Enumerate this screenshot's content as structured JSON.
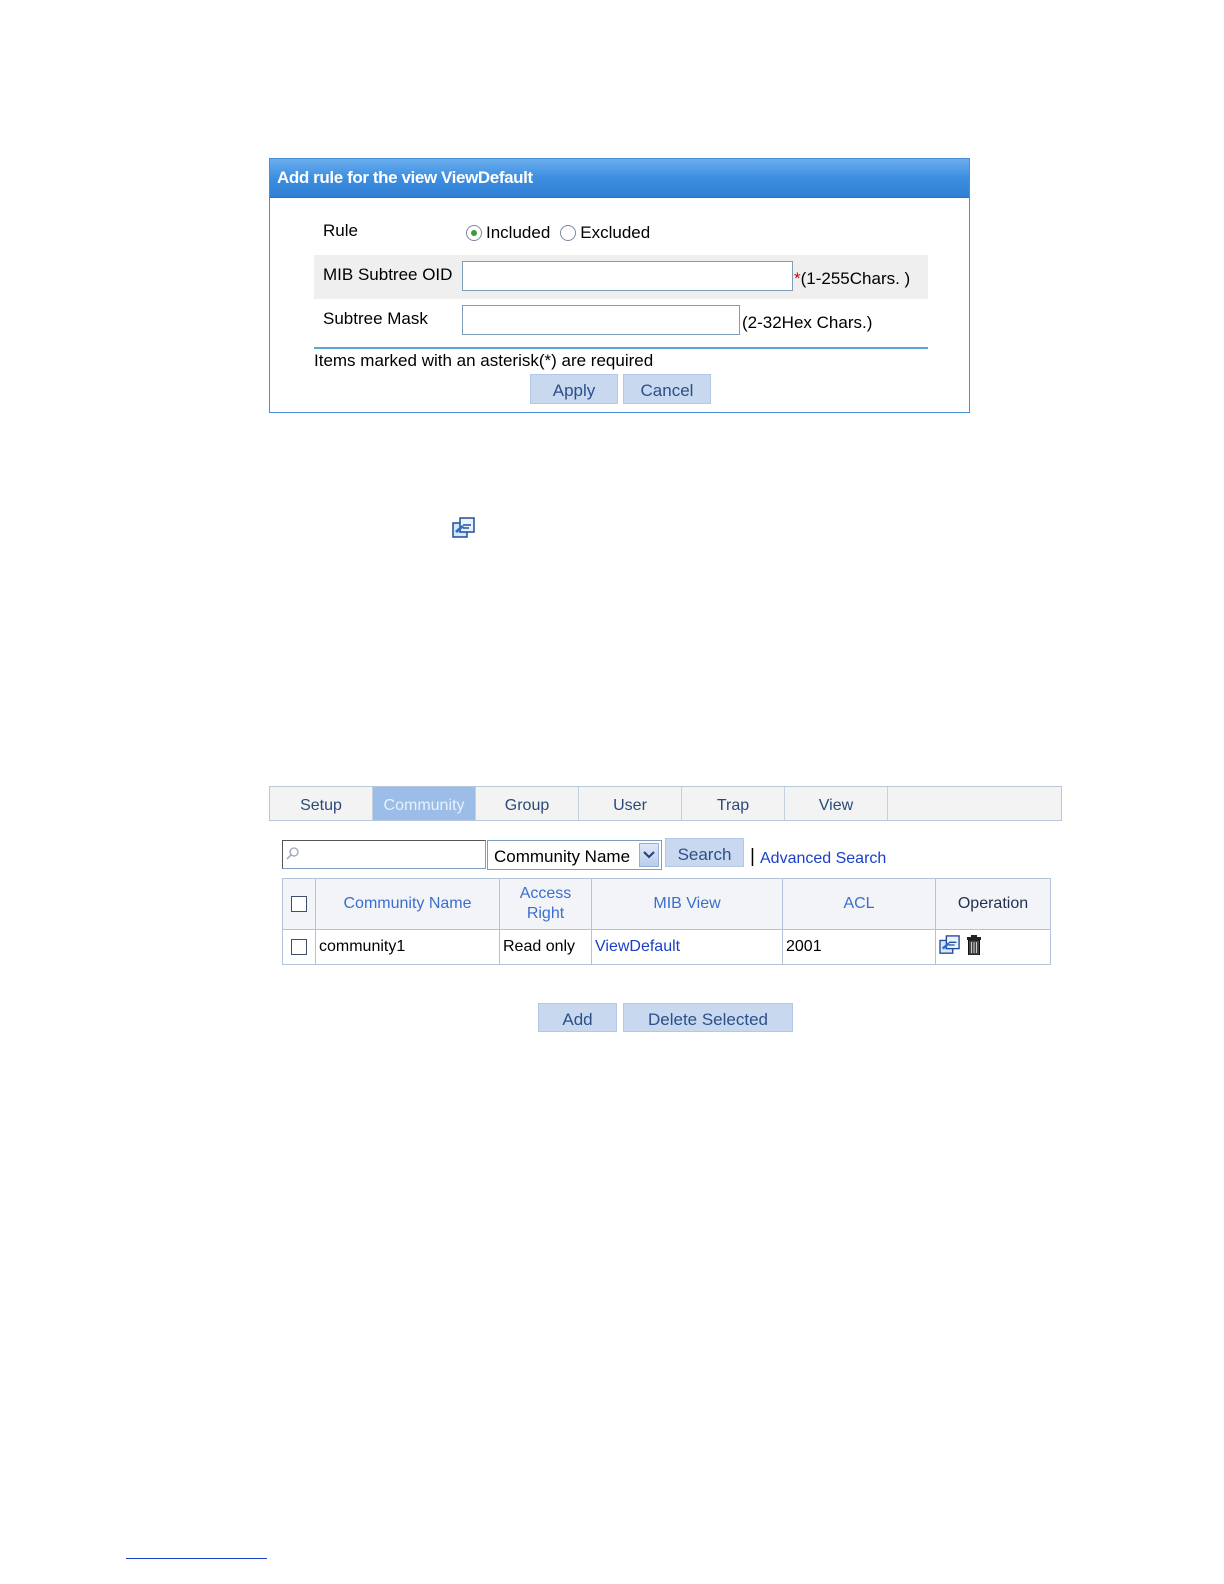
{
  "dialog": {
    "title": "Add rule for the view ViewDefault",
    "rule_label": "Rule",
    "rule_options": [
      "Included",
      "Excluded"
    ],
    "rule_selected": "Included",
    "oid_label": "MIB Subtree OID",
    "oid_value": "",
    "oid_required_mark": "*",
    "oid_hint": "(1-255Chars. )",
    "mask_label": "Subtree Mask",
    "mask_value": "",
    "mask_hint": "(2-32Hex Chars.)",
    "required_note": "Items marked with an asterisk(*) are required",
    "apply_label": "Apply",
    "cancel_label": "Cancel"
  },
  "tabs": {
    "items": [
      "Setup",
      "Community",
      "Group",
      "User",
      "Trap",
      "View"
    ],
    "active": "Community"
  },
  "search": {
    "value": "",
    "field_selected": "Community Name",
    "button_label": "Search",
    "separator": "|",
    "advanced_label": "Advanced Search"
  },
  "table": {
    "headers": {
      "name": "Community Name",
      "access": "Access Right",
      "view": "MIB View",
      "acl": "ACL",
      "operation": "Operation"
    },
    "rows": [
      {
        "name": "community1",
        "access": "Read only",
        "view": "ViewDefault",
        "acl": "2001"
      }
    ]
  },
  "actions": {
    "add_label": "Add",
    "delete_label": "Delete Selected"
  },
  "colors": {
    "title_bar": "#3d8ee0",
    "active_tab": "#9bbde8",
    "button_bg": "#c8d9ef",
    "link": "#1a3fc6",
    "required": "#d00000"
  }
}
